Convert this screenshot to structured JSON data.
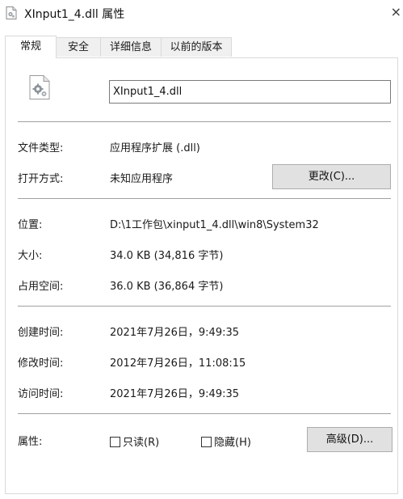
{
  "window": {
    "title": "XInput1_4.dll 属性",
    "close_glyph": "×"
  },
  "tabs": [
    {
      "label": "常规",
      "active": true
    },
    {
      "label": "安全",
      "active": false
    },
    {
      "label": "详细信息",
      "active": false
    },
    {
      "label": "以前的版本",
      "active": false
    }
  ],
  "file": {
    "name": "XInput1_4.dll",
    "icon": "dll-file-icon"
  },
  "general": {
    "type_label": "文件类型:",
    "type_value": "应用程序扩展 (.dll)",
    "open_label": "打开方式:",
    "open_value": "未知应用程序",
    "change_button": "更改(C)...",
    "location_label": "位置:",
    "location_value": "D:\\1工作包\\xinput1_4.dll\\win8\\System32",
    "size_label": "大小:",
    "size_value": "34.0 KB (34,816 字节)",
    "disk_label": "占用空间:",
    "disk_value": "36.0 KB (36,864 字节)",
    "created_label": "创建时间:",
    "created_value": "2021年7月26日，9:49:35",
    "modified_label": "修改时间:",
    "modified_value": "2012年7月26日，11:08:15",
    "accessed_label": "访问时间:",
    "accessed_value": "2021年7月26日，9:49:35",
    "attr_label": "属性:",
    "readonly_label": "只读(R)",
    "hidden_label": "隐藏(H)",
    "advanced_button": "高级(D)..."
  }
}
